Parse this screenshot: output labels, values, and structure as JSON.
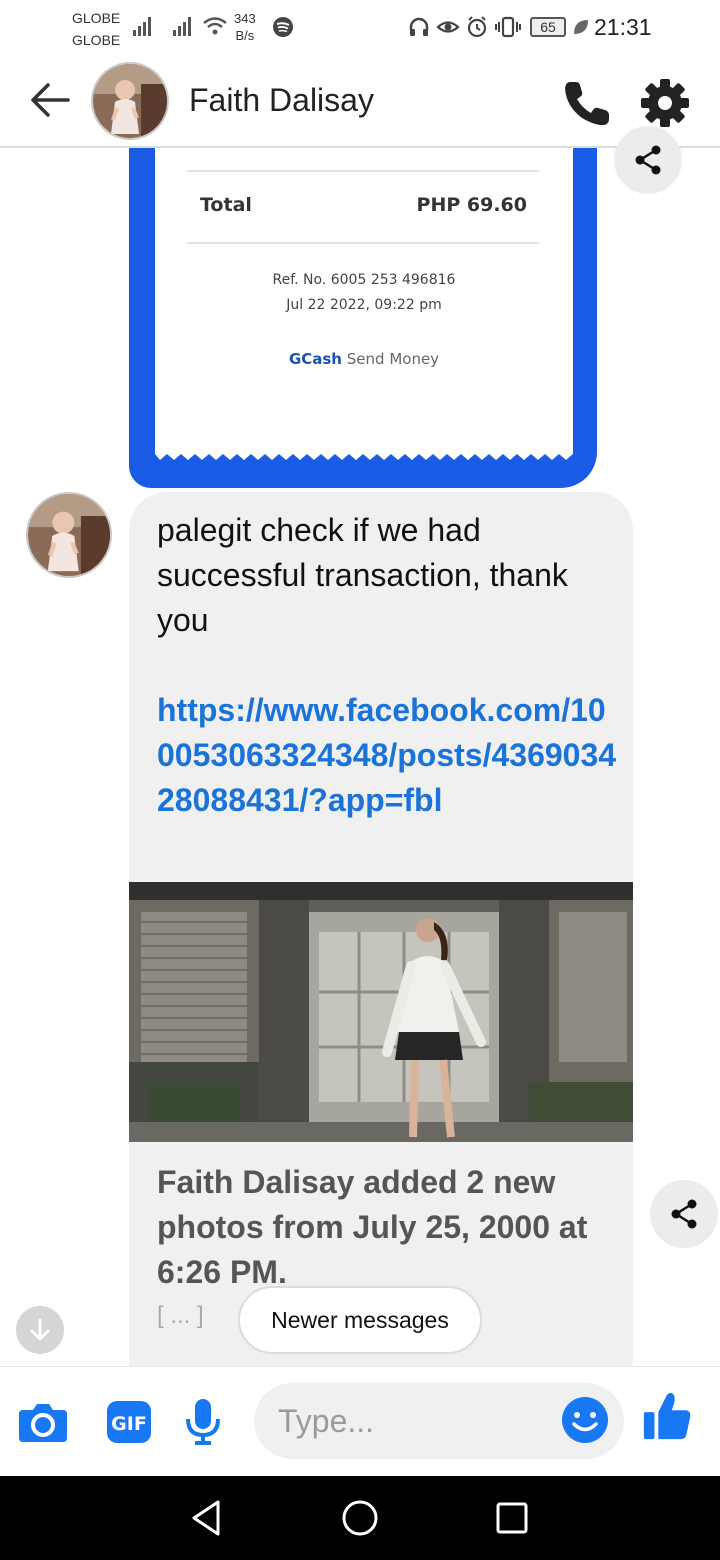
{
  "status_bar": {
    "carrier_1": "GLOBE",
    "carrier_2": "GLOBE",
    "net_speed_value": "343",
    "net_speed_unit": "B/s",
    "battery": "65",
    "time": "21:31"
  },
  "header": {
    "contact_name": "Faith Dalisay"
  },
  "receipt": {
    "total_label": "Total",
    "total_value": "PHP 69.60",
    "ref": "Ref. No. 6005 253 496816",
    "date": "Jul 22 2022, 09:22 pm",
    "brand": "GCash",
    "service": "Send Money"
  },
  "message": {
    "text": "palegit check if we had successful transaction, thank you",
    "link": "https://www.facebook.com/100053063324348/posts/436903428088431/?app=fbl",
    "preview_title": "Faith Dalisay added 2 new photos from July 25, 2000 at 6:26 PM.",
    "ellipsis": "[ ... ]"
  },
  "newer_messages_label": "Newer messages",
  "composer": {
    "placeholder": "Type...",
    "gif_label": "GIF"
  },
  "colors": {
    "messenger_blue": "#1877f2",
    "gcash_blue": "#1a5ce6",
    "link_blue": "#1a73d9",
    "bubble_gray": "#f1f0f0"
  },
  "icons": [
    "back-arrow-icon",
    "phone-icon",
    "gear-icon",
    "share-icon",
    "camera-icon",
    "gif-icon",
    "microphone-icon",
    "emoji-icon",
    "thumbs-up-icon",
    "arrow-down-icon",
    "nav-back-icon",
    "nav-home-icon",
    "nav-recents-icon"
  ]
}
